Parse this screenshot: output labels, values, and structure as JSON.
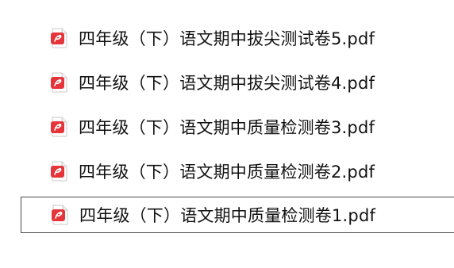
{
  "file_list": {
    "items": [
      {
        "name": "四年级（下）语文期中拔尖测试卷5.pdf",
        "icon": "pdf-file-icon",
        "selected": false
      },
      {
        "name": "四年级（下）语文期中拔尖测试卷4.pdf",
        "icon": "pdf-file-icon",
        "selected": false
      },
      {
        "name": "四年级（下）语文期中质量检测卷3.pdf",
        "icon": "pdf-file-icon",
        "selected": false
      },
      {
        "name": "四年级（下）语文期中质量检测卷2.pdf",
        "icon": "pdf-file-icon",
        "selected": false
      },
      {
        "name": "四年级（下）语文期中质量检测卷1.pdf",
        "icon": "pdf-file-icon",
        "selected": true
      }
    ]
  },
  "colors": {
    "pdf_red": "#e5343a",
    "selection_border": "#4a4a4a",
    "text": "#111111"
  }
}
